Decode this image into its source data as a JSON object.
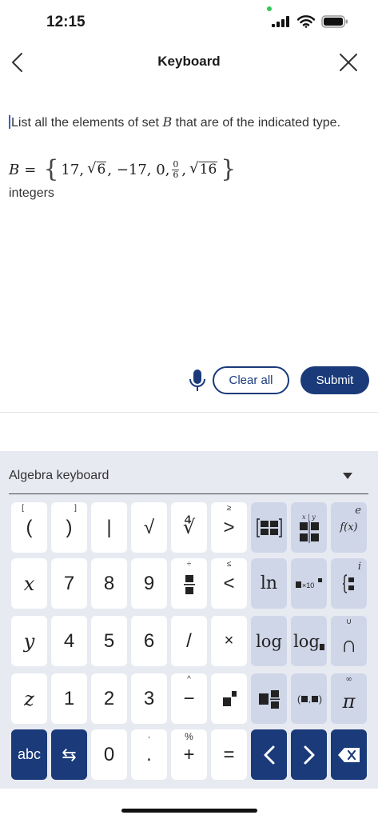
{
  "status_bar": {
    "time": "12:15"
  },
  "nav": {
    "title": "Keyboard"
  },
  "question": {
    "instruction_start": "List all the elements of set ",
    "set_var": "B",
    "instruction_end": " that are of the indicated type.",
    "set_label": "B",
    "equals": "=",
    "elements": {
      "e1": "17,",
      "sqrt1_radicand": "6",
      "e3": ", −17, 0,",
      "frac_num": "0",
      "frac_den": "6",
      "comma": ",",
      "sqrt2_radicand": "16"
    },
    "type": "integers"
  },
  "actions": {
    "clear_all": "Clear all",
    "submit": "Submit"
  },
  "keyboard": {
    "title": "Algebra keyboard",
    "row1": {
      "open_paren": "(",
      "open_paren_sup": "[",
      "close_paren": ")",
      "close_paren_sup": "]",
      "abs": "|",
      "sqrt": "√",
      "nth_root": "∜",
      "gt": ">",
      "gt_sup": "≥",
      "fx": "f(x)",
      "fx_sup": "e"
    },
    "row2": {
      "x": "x",
      "k7": "7",
      "k8": "8",
      "k9": "9",
      "div_sup": "÷",
      "lt": "<",
      "lt_sup": "≤",
      "ln": "ln",
      "sci": "×10",
      "i_sup": "i"
    },
    "row3": {
      "y": "y",
      "k4": "4",
      "k5": "5",
      "k6": "6",
      "slash": "/",
      "times": "×",
      "log": "log",
      "log_base": "log",
      "cap": "∩",
      "cup_sup": "∪"
    },
    "row4": {
      "z": "z",
      "k1": "1",
      "k2": "2",
      "k3": "3",
      "minus": "−",
      "caret_sup": "^",
      "pi": "π",
      "inf_sup": "∞"
    },
    "row5": {
      "abc": "abc",
      "swap": "⇆",
      "k0": "0",
      "dot": ".",
      "dot_sup": ",",
      "plus": "+",
      "percent_sup": "%",
      "equals": "="
    }
  },
  "colors": {
    "accent": "#1a3a7a",
    "keyboard_bg": "#e8eaf2",
    "blue_key": "#cfd6e8"
  }
}
